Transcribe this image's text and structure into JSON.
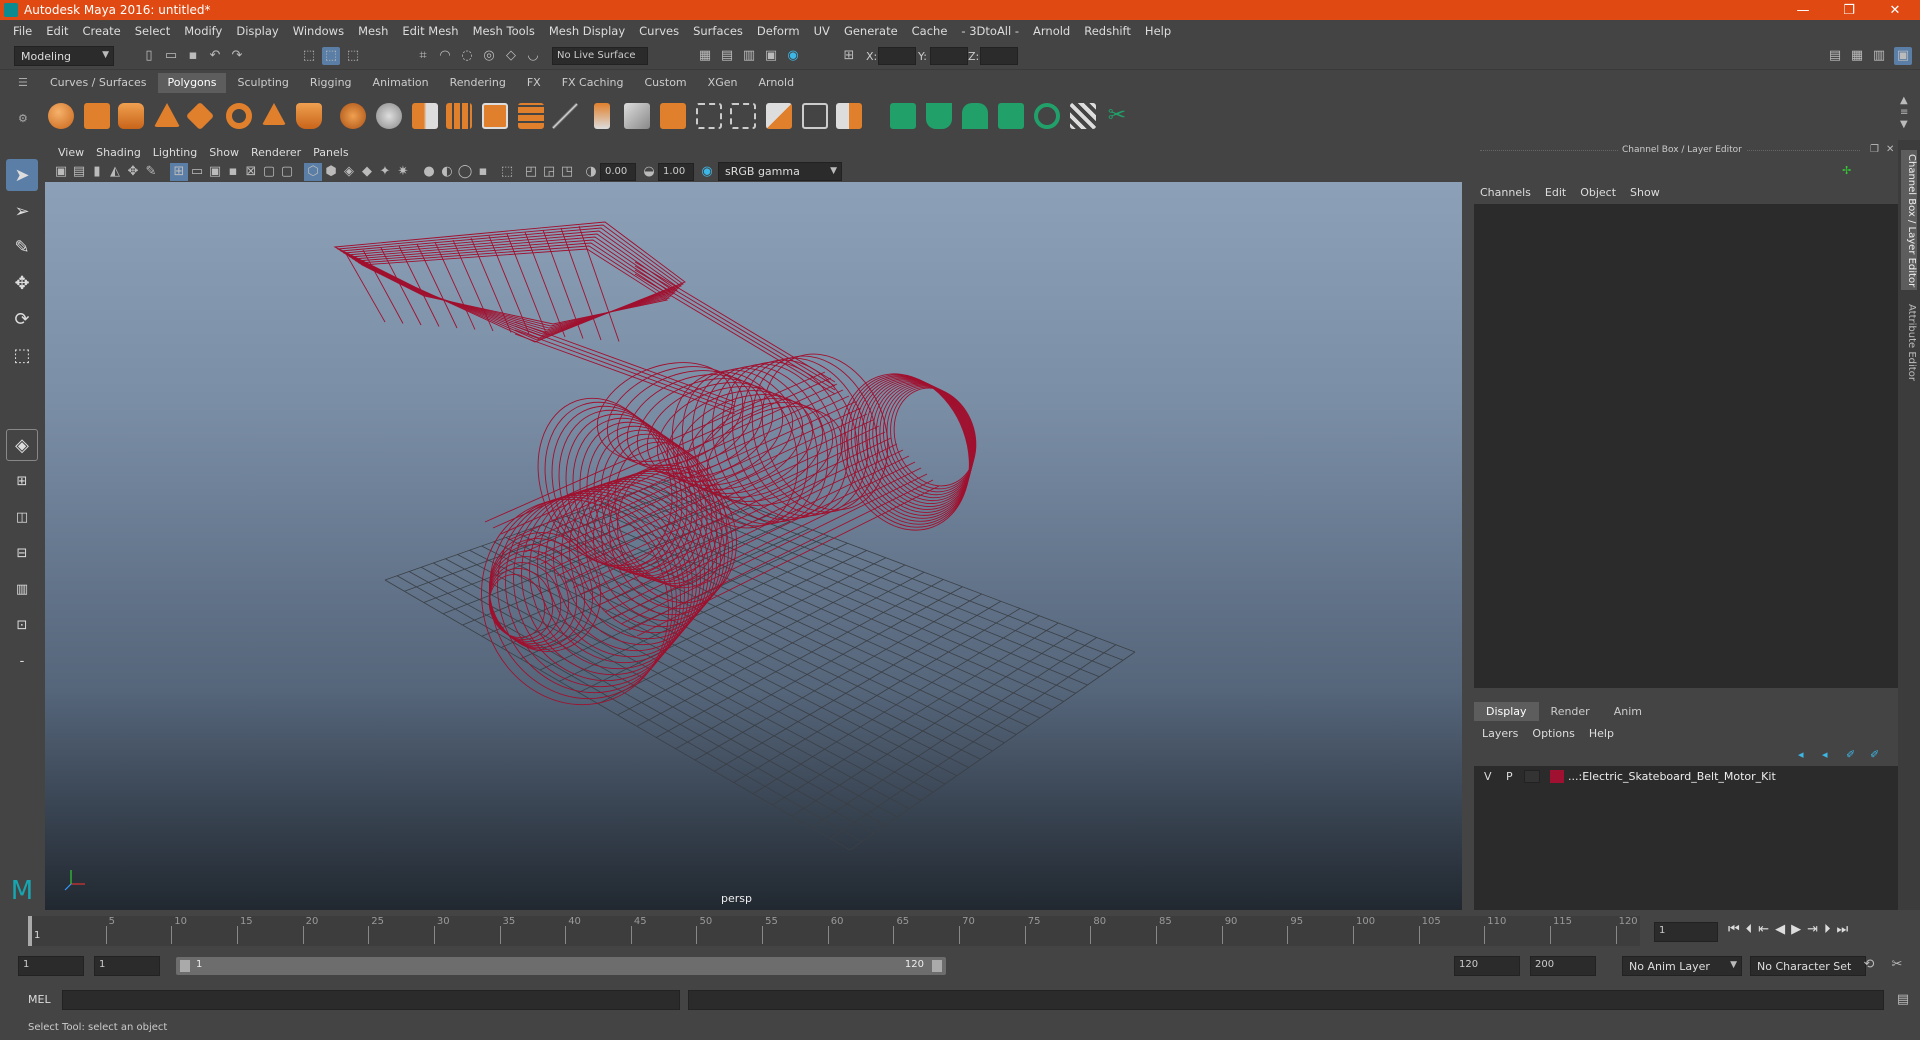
{
  "window": {
    "title": "Autodesk Maya 2016: untitled*",
    "minimize": "—",
    "maximize": "❐",
    "close": "✕"
  },
  "menubar": [
    "File",
    "Edit",
    "Create",
    "Select",
    "Modify",
    "Display",
    "Windows",
    "Mesh",
    "Edit Mesh",
    "Mesh Tools",
    "Mesh Display",
    "Curves",
    "Surfaces",
    "Deform",
    "UV",
    "Generate",
    "Cache",
    "- 3DtoAll -",
    "Arnold",
    "Redshift",
    "Help"
  ],
  "statusline": {
    "menuset": "Modeling",
    "live_surface": "No Live Surface",
    "x_label": "X:",
    "y_label": "Y:",
    "z_label": "Z:"
  },
  "shelf_tabs": [
    "Curves / Surfaces",
    "Polygons",
    "Sculpting",
    "Rigging",
    "Animation",
    "Rendering",
    "FX",
    "FX Caching",
    "Custom",
    "XGen",
    "Arnold"
  ],
  "shelf_active": "Polygons",
  "viewport": {
    "menu": [
      "View",
      "Shading",
      "Lighting",
      "Show",
      "Renderer",
      "Panels"
    ],
    "exposure": "0.00",
    "gamma": "1.00",
    "color_space": "sRGB gamma",
    "camera_label": "persp",
    "wire_color": "#a0102e"
  },
  "channelbox": {
    "title": "Channel Box / Layer Editor",
    "menu": [
      "Channels",
      "Edit",
      "Object",
      "Show"
    ],
    "layer_tabs": [
      "Display",
      "Render",
      "Anim"
    ],
    "layer_active": "Display",
    "layer_menu": [
      "Layers",
      "Options",
      "Help"
    ],
    "layer": {
      "v": "V",
      "p": "P",
      "name": "...:Electric_Skateboard_Belt_Motor_Kit",
      "color": "#a01030"
    }
  },
  "side_tabs": [
    "Channel Box / Layer Editor",
    "Attribute Editor"
  ],
  "timeline": {
    "ticks": [
      "5",
      "10",
      "15",
      "20",
      "25",
      "30",
      "35",
      "40",
      "45",
      "50",
      "55",
      "60",
      "65",
      "70",
      "75",
      "80",
      "85",
      "90",
      "95",
      "100",
      "105",
      "110",
      "115",
      "120"
    ],
    "current_frame": "1",
    "current_field": "1"
  },
  "range": {
    "start": "1",
    "playback_start": "1",
    "slider_start": "1",
    "slider_end": "120",
    "playback_end": "120",
    "end": "200",
    "anim_layer": "No Anim Layer",
    "character_set": "No Character Set"
  },
  "mel": {
    "label": "MEL"
  },
  "help_text": "Select Tool: select an object"
}
